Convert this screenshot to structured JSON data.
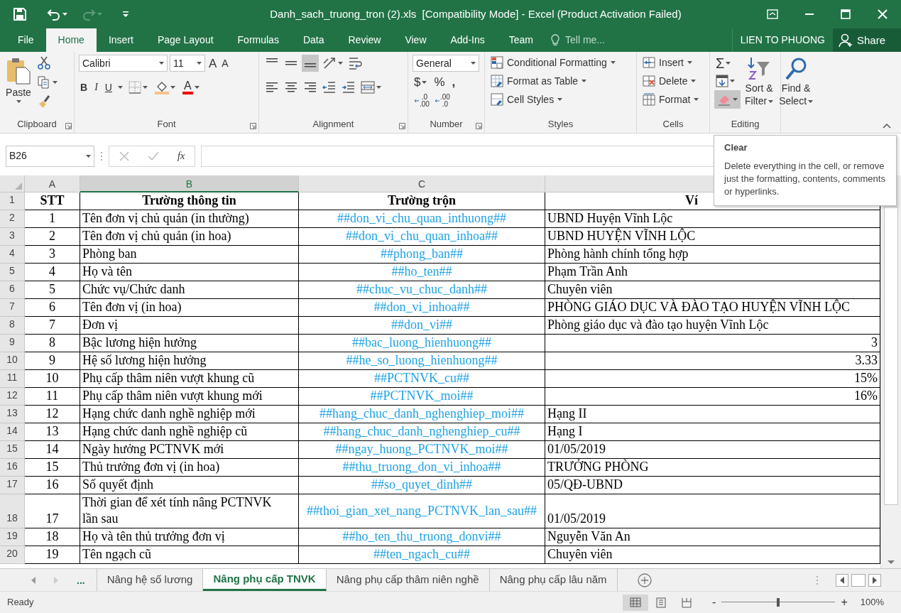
{
  "title_bar": {
    "title": "Danh_sach_truong_tron (2).xls  [Compatibility Mode] - Excel (Product Activation Failed)",
    "redo_disabled": true
  },
  "menu_tabs": [
    {
      "label": "File",
      "selected": false
    },
    {
      "label": "Home",
      "selected": true
    },
    {
      "label": "Insert",
      "selected": false
    },
    {
      "label": "Page Layout",
      "selected": false
    },
    {
      "label": "Formulas",
      "selected": false
    },
    {
      "label": "Data",
      "selected": false
    },
    {
      "label": "Review",
      "selected": false
    },
    {
      "label": "View",
      "selected": false
    },
    {
      "label": "Add-Ins",
      "selected": false
    },
    {
      "label": "Team",
      "selected": false
    }
  ],
  "tell_me": {
    "placeholder": "Tell me..."
  },
  "user": "LIEN TO PHUONG",
  "share": "Share",
  "ribbon": {
    "clipboard": {
      "label": "Clipboard",
      "paste": "Paste"
    },
    "font": {
      "label": "Font",
      "name": "Calibri",
      "size": "11",
      "grow": "A",
      "shrink": "A",
      "bold": "B",
      "italic": "I",
      "underline": "U",
      "font_color": "A"
    },
    "alignment": {
      "label": "Alignment",
      "bottom_align_selected": true
    },
    "number": {
      "label": "Number",
      "format": "General",
      "currency": "$",
      "percent": "%",
      "comma": ",",
      "increase_decimal": [
        ".0",
        ".00"
      ],
      "decrease_decimal": [
        ".00",
        ".0"
      ]
    },
    "styles": {
      "label": "Styles",
      "items": [
        "Conditional Formatting",
        "Format as Table",
        "Cell Styles"
      ]
    },
    "cells": {
      "label": "Cells",
      "items": [
        "Insert",
        "Delete",
        "Format"
      ]
    },
    "editing": {
      "label": "Editing",
      "autosum": "Σ",
      "clear_highlighted": true,
      "sort": [
        "Sort &",
        "Filter"
      ],
      "find": [
        "Find &",
        "Select"
      ]
    }
  },
  "name_box": "B26",
  "function_label": "fx",
  "columns": [
    {
      "label": "A",
      "selected": false
    },
    {
      "label": "B",
      "selected": true
    },
    {
      "label": "C",
      "selected": false
    }
  ],
  "rows": [
    {
      "number": "1",
      "kind": "header",
      "cells": [
        "STT",
        "Trường thông tin",
        "Trường trộn",
        "Ví"
      ]
    },
    {
      "number": "2",
      "kind": "text",
      "cells": [
        "1",
        "Tên đơn vị chủ quản (in thường)",
        "##don_vi_chu_quan_inthuong##",
        "UBND Huyện Vĩnh Lộc"
      ]
    },
    {
      "number": "3",
      "kind": "text",
      "cells": [
        "2",
        "Tên đơn vị chủ quản (in hoa)",
        "##don_vi_chu_quan_inhoa##",
        "UBND HUYỆN VĨNH LỘC"
      ]
    },
    {
      "number": "4",
      "kind": "text",
      "cells": [
        "3",
        "Phòng ban",
        "##phong_ban##",
        "Phòng hành chính tổng hợp"
      ]
    },
    {
      "number": "5",
      "kind": "text",
      "cells": [
        "4",
        "Họ và tên",
        "##ho_ten##",
        "Phạm Trần Anh"
      ]
    },
    {
      "number": "6",
      "kind": "text",
      "cells": [
        "5",
        "Chức vụ/Chức danh",
        "##chuc_vu_chuc_danh##",
        "Chuyên viên"
      ]
    },
    {
      "number": "7",
      "kind": "text",
      "cells": [
        "6",
        "Tên đơn vị (in hoa)",
        "##don_vi_inhoa##",
        "PHÒNG GIÁO DỤC VÀ ĐÀO TẠO HUYỆN VĨNH LỘC"
      ]
    },
    {
      "number": "8",
      "kind": "text",
      "cells": [
        "7",
        "Đơn vị",
        "##don_vi##",
        "Phòng giáo dục và đào tạo huyện Vĩnh Lộc"
      ]
    },
    {
      "number": "9",
      "kind": "number",
      "cells": [
        "8",
        "Bậc lương hiện hưởng",
        "##bac_luong_hienhuong##",
        "3"
      ]
    },
    {
      "number": "10",
      "kind": "number",
      "cells": [
        "9",
        "Hệ số lương hiện hưởng",
        "##he_so_luong_hienhuong##",
        "3.33"
      ]
    },
    {
      "number": "11",
      "kind": "number",
      "cells": [
        "10",
        "Phụ cấp thâm niên vượt khung cũ",
        "##PCTNVK_cu##",
        "15%"
      ]
    },
    {
      "number": "12",
      "kind": "number",
      "cells": [
        "11",
        "Phụ cấp thâm niên vượt khung mới",
        "##PCTNVK_moi##",
        "16%"
      ]
    },
    {
      "number": "13",
      "kind": "text",
      "cells": [
        "12",
        "Hạng chức danh nghề nghiệp mới",
        "##hang_chuc_danh_nghenghiep_moi##",
        "Hạng II"
      ]
    },
    {
      "number": "14",
      "kind": "text",
      "cells": [
        "13",
        "Hạng chức danh nghề nghiệp cũ",
        "##hang_chuc_danh_nghenghiep_cu##",
        "Hạng I"
      ]
    },
    {
      "number": "15",
      "kind": "text",
      "cells": [
        "14",
        "Ngày hưởng PCTNVK mới",
        "##ngay_huong_PCTNVK_moi##",
        "01/05/2019"
      ]
    },
    {
      "number": "16",
      "kind": "text",
      "cells": [
        "15",
        "Thủ trưởng đơn vị (in hoa)",
        "##thu_truong_don_vi_inhoa##",
        "TRƯỞNG PHÒNG"
      ]
    },
    {
      "number": "17",
      "kind": "text",
      "cells": [
        "16",
        "Số quyết định",
        "##so_quyet_dinh##",
        "05/QĐ-UBND"
      ]
    },
    {
      "number": "18",
      "kind": "text",
      "cells": [
        "17",
        "Thời gian để xét tính nâng PCTNVK lần sau",
        "##thoi_gian_xet_nang_PCTNVK_lan_sau##",
        "01/05/2019"
      ]
    },
    {
      "number": "19",
      "kind": "text",
      "cells": [
        "18",
        "Họ và tên thủ trưởng đơn vị",
        "##ho_ten_thu_truong_donvi##",
        "Nguyễn Văn An"
      ]
    },
    {
      "number": "20",
      "kind": "text",
      "cells": [
        "19",
        "Tên ngạch cũ",
        "##ten_ngach_cu##",
        "Chuyên viên"
      ]
    }
  ],
  "tooltip": {
    "title": "Clear",
    "text": "Delete everything in the cell, or remove just the formatting, contents, comments or hyperlinks."
  },
  "sheet_more": "...",
  "sheet_tabs": [
    {
      "label": "Nâng hệ số lương",
      "selected": false
    },
    {
      "label": "Nâng phụ cấp TNVK",
      "selected": true
    },
    {
      "label": "Nâng phụ cấp thâm niên nghề",
      "selected": false
    },
    {
      "label": "Nâng phụ cấp lâu năm",
      "selected": false
    }
  ],
  "status_bar": {
    "text": "Ready",
    "views": [
      {
        "selected": true
      },
      {
        "selected": false
      },
      {
        "selected": false
      }
    ],
    "zoom_out": "-",
    "zoom_in": "+",
    "zoom": "100%",
    "zoom_slider": {
      "level": 0.5
    }
  }
}
